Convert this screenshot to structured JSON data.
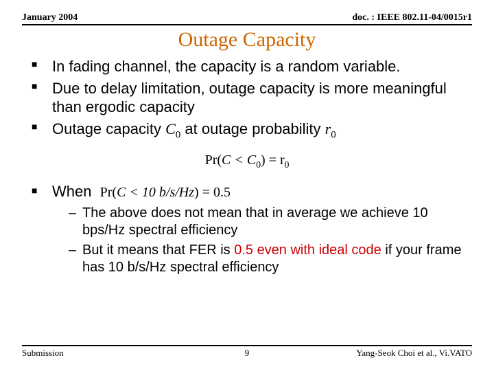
{
  "header": {
    "date": "January 2004",
    "doc": "doc. : IEEE 802.11-04/0015r1"
  },
  "title": "Outage Capacity",
  "bullets": {
    "b1": "In fading channel, the capacity is a random variable.",
    "b2": "Due to delay limitation, outage capacity is more meaningful than ergodic capacity",
    "b3_a": "Outage capacity ",
    "b3_b": " at  outage probability "
  },
  "symbols": {
    "C0": "C",
    "C0_sub": "0",
    "r0": "r",
    "r0_sub": "0"
  },
  "equation_center": {
    "pr": "Pr(",
    "body": "C < C",
    "body_sub": "0",
    "close": ") = r",
    "close_sub": "0"
  },
  "when": {
    "label": "When",
    "cond_pr": "Pr(",
    "cond_body": "C < 10 b/s/Hz",
    "cond_close": ") = 0.5"
  },
  "sub": {
    "s1": "The above does not mean that in average we achieve 10 bps/Hz spectral efficiency",
    "s2a": "But it means that FER is ",
    "s2b": "0.5 even with ideal code",
    "s2c": " if your frame has 10 b/s/Hz spectral efficiency"
  },
  "footer": {
    "left": "Submission",
    "page": "9",
    "right": "Yang-Seok Choi et al., Vi.VATO"
  }
}
